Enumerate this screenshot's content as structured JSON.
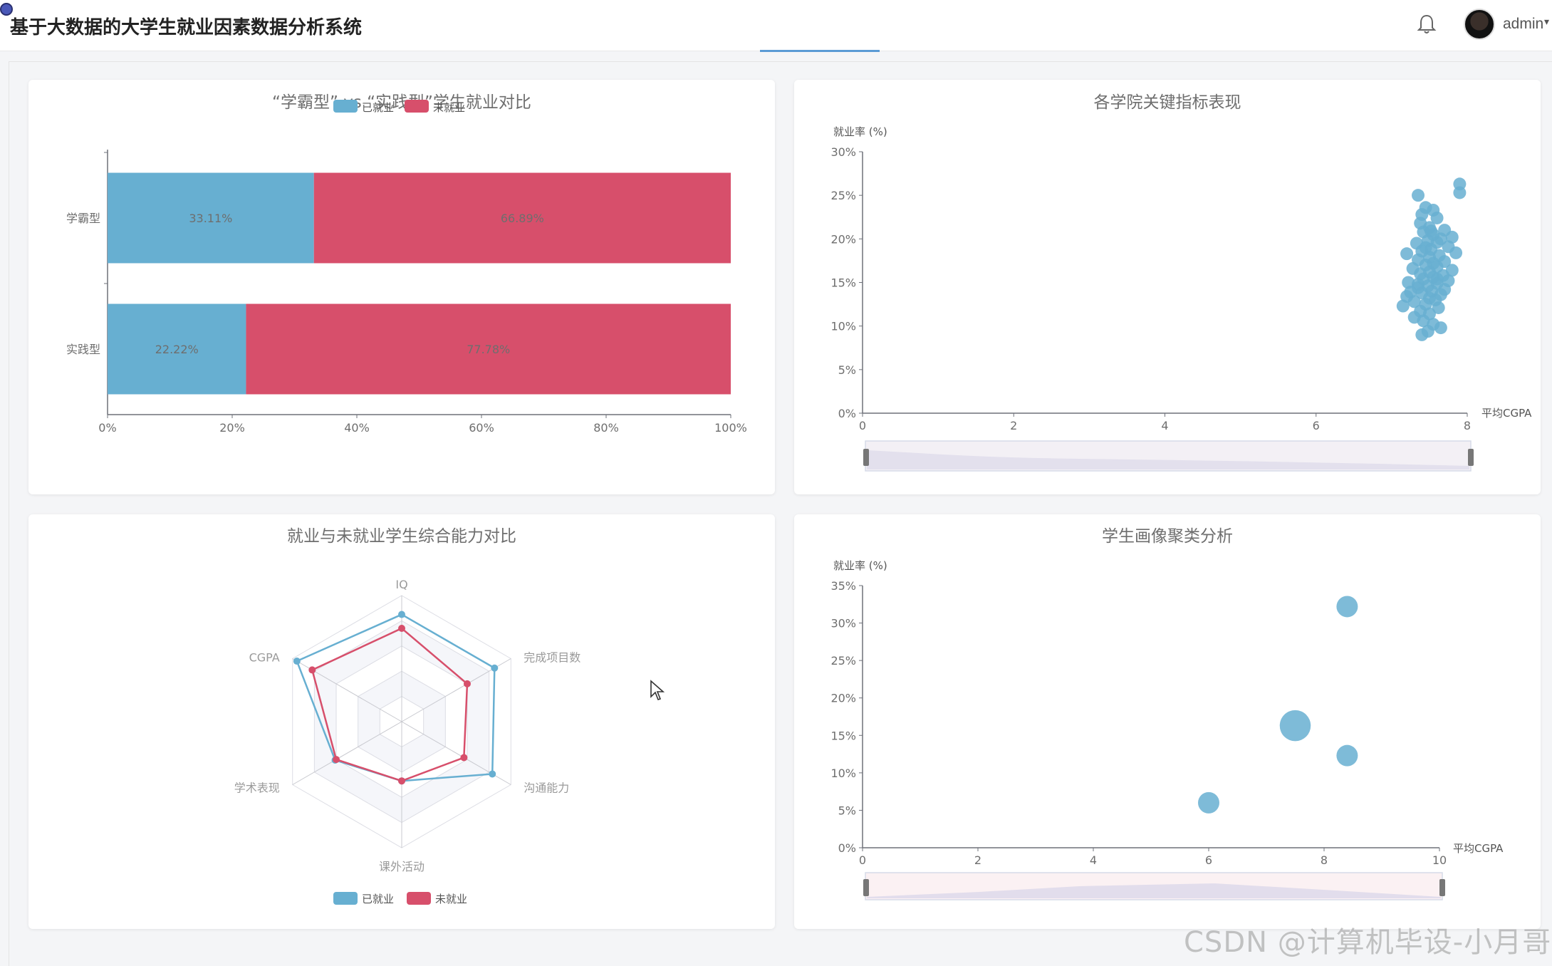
{
  "header": {
    "title": "基于大数据的大学生就业因素数据分析系统",
    "username": "admin",
    "caret": "▾"
  },
  "watermark": "CSDN @计算机毕设-小月哥",
  "colors": {
    "employed": "#67afd1",
    "unemployed": "#d74f6b",
    "bubble": "#67afd1"
  },
  "chart_data": [
    {
      "type": "bar",
      "orientation": "horizontal-stacked-percent",
      "title": "“学霸型” vs “实践型”学生就业对比",
      "legend": [
        "已就业",
        "未就业"
      ],
      "legend_position": "top",
      "categories": [
        "学霸型",
        "实践型"
      ],
      "series": [
        {
          "name": "已就业",
          "values": [
            33.11,
            22.22
          ],
          "labels": [
            "33.11%",
            "22.22%"
          ]
        },
        {
          "name": "未就业",
          "values": [
            66.89,
            77.78
          ],
          "labels": [
            "66.89%",
            "77.78%"
          ]
        }
      ],
      "xlim": [
        0,
        100
      ],
      "xticks": [
        "0%",
        "20%",
        "40%",
        "60%",
        "80%",
        "100%"
      ]
    },
    {
      "type": "scatter",
      "title": "各学院关键指标表现",
      "xlabel": "平均CGPA",
      "ylabel": "就业率 (%)",
      "xlim": [
        0,
        8
      ],
      "ylim": [
        0,
        30
      ],
      "xticks": [
        "0",
        "2",
        "4",
        "6",
        "8"
      ],
      "yticks": [
        "0%",
        "5%",
        "10%",
        "15%",
        "20%",
        "25%",
        "30%"
      ],
      "points": [
        [
          7.9,
          26.3
        ],
        [
          7.9,
          25.3
        ],
        [
          7.35,
          25.0
        ],
        [
          7.45,
          23.6
        ],
        [
          7.55,
          23.3
        ],
        [
          7.4,
          22.8
        ],
        [
          7.6,
          22.4
        ],
        [
          7.38,
          21.8
        ],
        [
          7.5,
          21.3
        ],
        [
          7.7,
          21.0
        ],
        [
          7.42,
          20.8
        ],
        [
          7.55,
          20.5
        ],
        [
          7.8,
          20.2
        ],
        [
          7.65,
          20.0
        ],
        [
          7.48,
          19.8
        ],
        [
          7.33,
          19.5
        ],
        [
          7.6,
          19.6
        ],
        [
          7.75,
          19.1
        ],
        [
          7.52,
          18.8
        ],
        [
          7.4,
          18.6
        ],
        [
          7.85,
          18.4
        ],
        [
          7.2,
          18.3
        ],
        [
          7.63,
          18.1
        ],
        [
          7.5,
          17.9
        ],
        [
          7.35,
          17.6
        ],
        [
          7.7,
          17.4
        ],
        [
          7.55,
          17.2
        ],
        [
          7.45,
          17.0
        ],
        [
          7.6,
          16.8
        ],
        [
          7.28,
          16.6
        ],
        [
          7.8,
          16.4
        ],
        [
          7.5,
          16.2
        ],
        [
          7.38,
          16.0
        ],
        [
          7.68,
          15.8
        ],
        [
          7.55,
          15.6
        ],
        [
          7.42,
          15.4
        ],
        [
          7.75,
          15.2
        ],
        [
          7.22,
          15.0
        ],
        [
          7.6,
          14.9
        ],
        [
          7.48,
          14.6
        ],
        [
          7.35,
          14.4
        ],
        [
          7.7,
          14.2
        ],
        [
          7.53,
          14.0
        ],
        [
          7.4,
          13.8
        ],
        [
          7.65,
          13.6
        ],
        [
          7.2,
          13.4
        ],
        [
          7.5,
          13.2
        ],
        [
          7.58,
          13.0
        ],
        [
          7.3,
          12.8
        ],
        [
          7.45,
          12.5
        ],
        [
          7.15,
          12.3
        ],
        [
          7.62,
          12.1
        ],
        [
          7.38,
          11.7
        ],
        [
          7.5,
          11.4
        ],
        [
          7.3,
          11.0
        ],
        [
          7.42,
          10.6
        ],
        [
          7.55,
          10.2
        ],
        [
          7.65,
          9.8
        ],
        [
          7.48,
          9.4
        ],
        [
          7.4,
          9.0
        ],
        [
          7.6,
          15.4
        ],
        [
          7.45,
          19.0
        ],
        [
          7.35,
          14.8
        ],
        [
          7.52,
          20.9
        ],
        [
          7.25,
          13.9
        ]
      ]
    },
    {
      "type": "radar",
      "title": "就业与未就业学生综合能力对比",
      "indicators": [
        "IQ",
        "完成项目数",
        "沟通能力",
        "课外活动",
        "学术表现",
        "CGPA"
      ],
      "legend": [
        "已就业",
        "未就业"
      ],
      "legend_position": "bottom",
      "series": [
        {
          "name": "已就业",
          "values": [
            0.85,
            0.85,
            0.83,
            0.47,
            0.61,
            0.96
          ]
        },
        {
          "name": "未就业",
          "values": [
            0.74,
            0.6,
            0.57,
            0.47,
            0.6,
            0.82
          ]
        }
      ]
    },
    {
      "type": "scatter",
      "subtype": "bubble",
      "title": "学生画像聚类分析",
      "xlabel": "平均CGPA",
      "ylabel": "就业率 (%)",
      "xlim": [
        0,
        10
      ],
      "ylim": [
        0,
        35
      ],
      "xticks": [
        "0",
        "2",
        "4",
        "6",
        "8",
        "10"
      ],
      "yticks": [
        "0%",
        "5%",
        "10%",
        "15%",
        "20%",
        "25%",
        "30%",
        "35%"
      ],
      "points": [
        {
          "x": 8.4,
          "y": 32.2,
          "size": 1
        },
        {
          "x": 7.5,
          "y": 16.3,
          "size": 1.45
        },
        {
          "x": 8.4,
          "y": 12.3,
          "size": 1
        },
        {
          "x": 6.0,
          "y": 6.0,
          "size": 1
        }
      ]
    }
  ]
}
